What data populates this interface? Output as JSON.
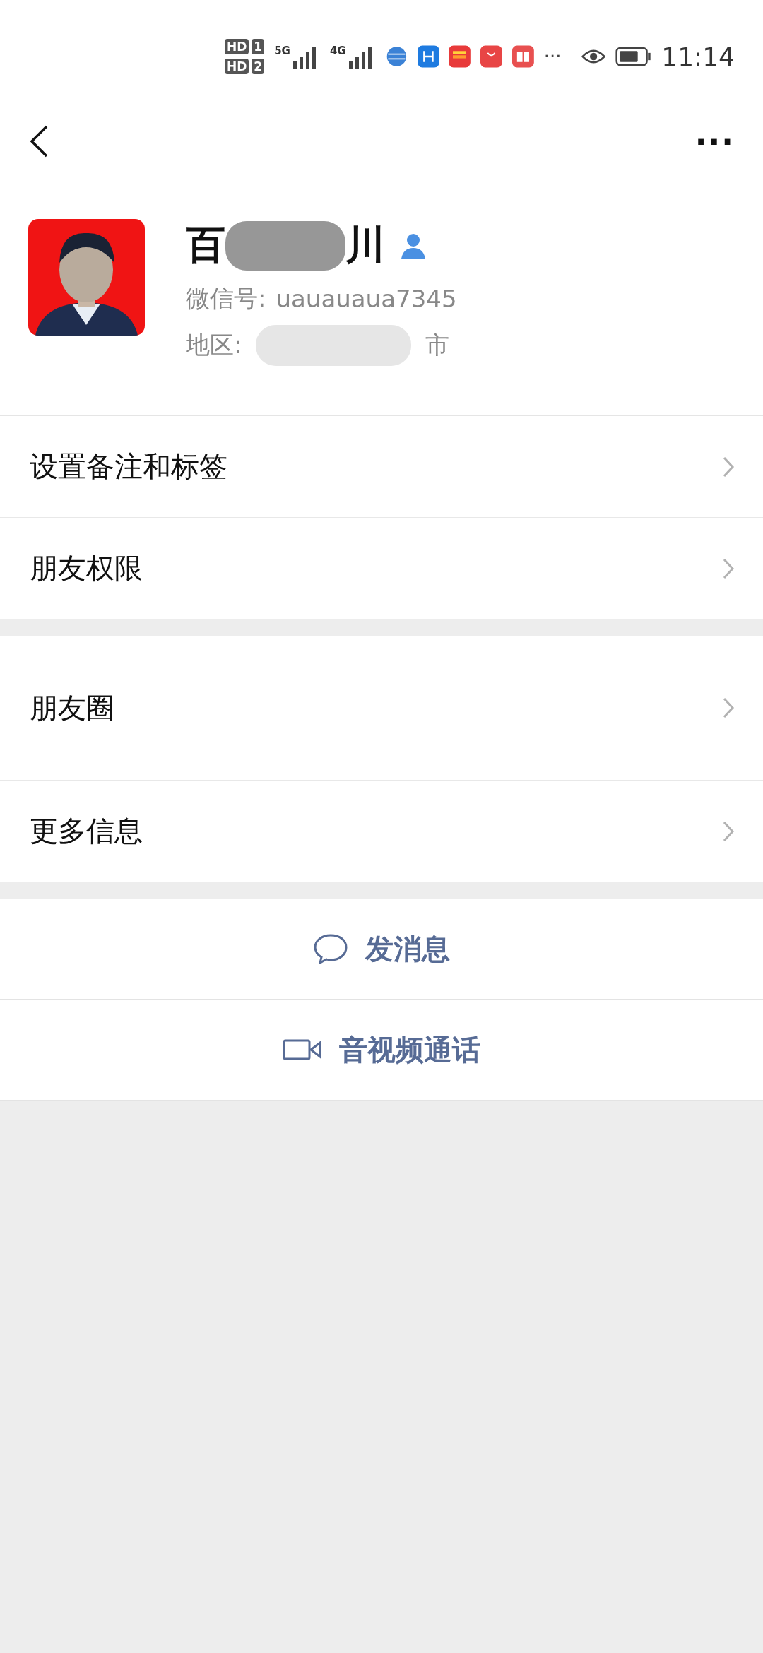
{
  "status_bar": {
    "sim_badges": [
      {
        "label": "HD",
        "slot": "1"
      },
      {
        "label": "HD",
        "slot": "2"
      }
    ],
    "networks": [
      "5G",
      "4G"
    ],
    "more": "···",
    "time": "11:14"
  },
  "nav": {
    "more": "···"
  },
  "profile": {
    "kind": "picture",
    "name_start": "百",
    "name_end": "川",
    "wechat_id_label": "微信号:",
    "wechat_id": "uauauaua7345",
    "region_label": "地区:",
    "region_end": "市"
  },
  "sections": [
    {
      "rows": [
        {
          "label": "设置备注和标签",
          "kind": "normal"
        },
        {
          "label": "朋友权限",
          "kind": "normal"
        }
      ]
    },
    {
      "rows": [
        {
          "label": "朋友圈",
          "kind": "tall"
        },
        {
          "label": "更多信息",
          "kind": "normal"
        }
      ]
    }
  ],
  "actions": [
    {
      "label": "发消息",
      "kind": "message"
    },
    {
      "label": "音视频通话",
      "kind": "video"
    }
  ]
}
